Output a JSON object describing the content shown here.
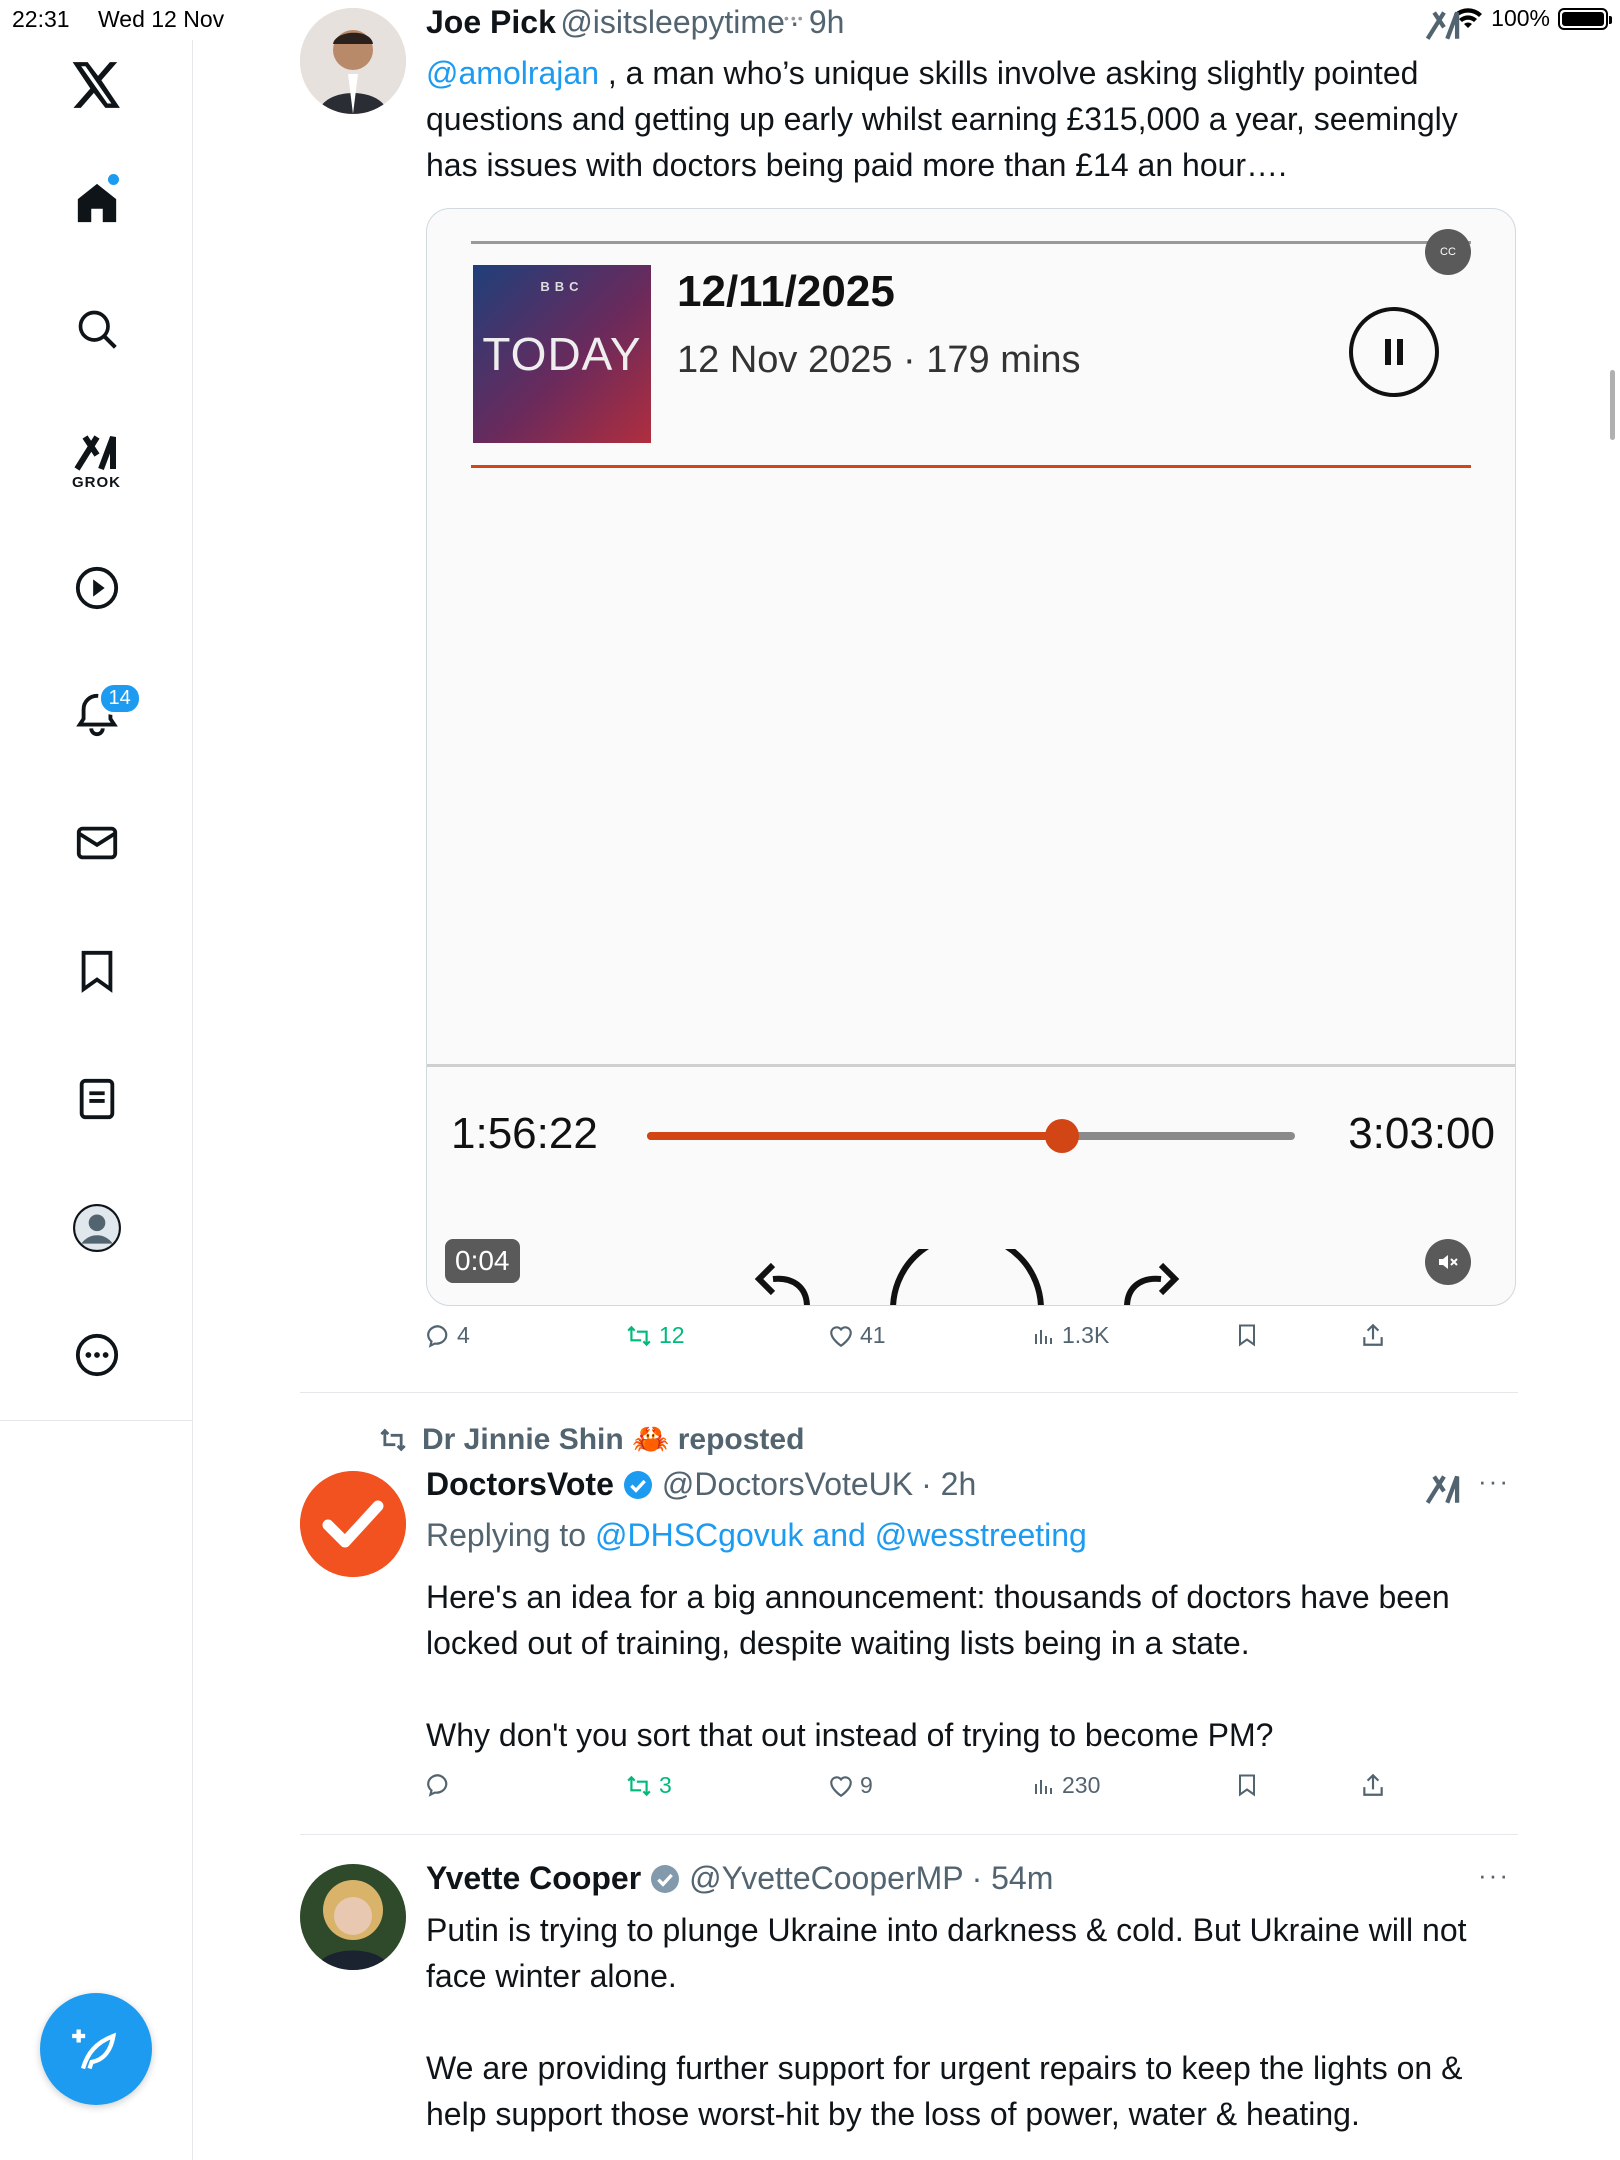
{
  "status_bar": {
    "time": "22:31",
    "date": "Wed 12 Nov",
    "battery": "100%"
  },
  "sidebar": {
    "grok_label": "GROK",
    "notifications_badge": "14",
    "items": [
      "x-logo",
      "home",
      "search",
      "grok",
      "video",
      "notifications",
      "messages",
      "bookmarks",
      "lists",
      "profile",
      "more"
    ]
  },
  "tweets": [
    {
      "name": "Joe Pick",
      "handle": "@isitsleepytime",
      "time": "· 9h",
      "mention": "@amolrajan",
      "text": " , a man who’s unique skills involve asking slightly pointed questions and getting up early whilst earning £315,000 a year, seemingly has issues with doctors being paid more than £14 an hour….",
      "media": {
        "logo_top": "BBC",
        "logo_text": "TODAY",
        "episode_title": "12/11/2025",
        "episode_meta": "12 Nov 2025 · 179 mins",
        "cc_label": "CC",
        "elapsed": "1:56:22",
        "total": "3:03:00",
        "progress": 0.64,
        "video_time": "0:04"
      },
      "stats": {
        "replies": "4",
        "reposts": "12",
        "likes": "41",
        "views": "1.3K"
      }
    },
    {
      "repost_by": "Dr Jinnie Shin 🦀 reposted",
      "name": "DoctorsVote",
      "handle": "@DoctorsVoteUK",
      "time": "· 2h",
      "replying_prefix": "Replying to ",
      "replying_to": "@DHSCgovuk and @wesstreeting",
      "text1": "Here's an idea for a big announcement: thousands of doctors have been locked out of training, despite waiting lists being in a state.",
      "text2": "Why don't you sort that out instead of trying to become PM?",
      "stats": {
        "replies": "",
        "reposts": "3",
        "likes": "9",
        "views": "230"
      }
    },
    {
      "name": "Yvette Cooper",
      "handle": "@YvetteCooperMP",
      "time": "· 54m",
      "text1": "Putin is trying to plunge Ukraine into darkness & cold. But Ukraine will not face winter alone.",
      "text2": "We are providing further support for urgent repairs to keep the lights on & help support those worst-hit by the loss of power, water & heating."
    }
  ],
  "colors": {
    "accent": "#1d9bf0",
    "repost_green": "#00ba7c",
    "player_orange": "#d24515",
    "doctorsvote_orange": "#f2521f"
  }
}
